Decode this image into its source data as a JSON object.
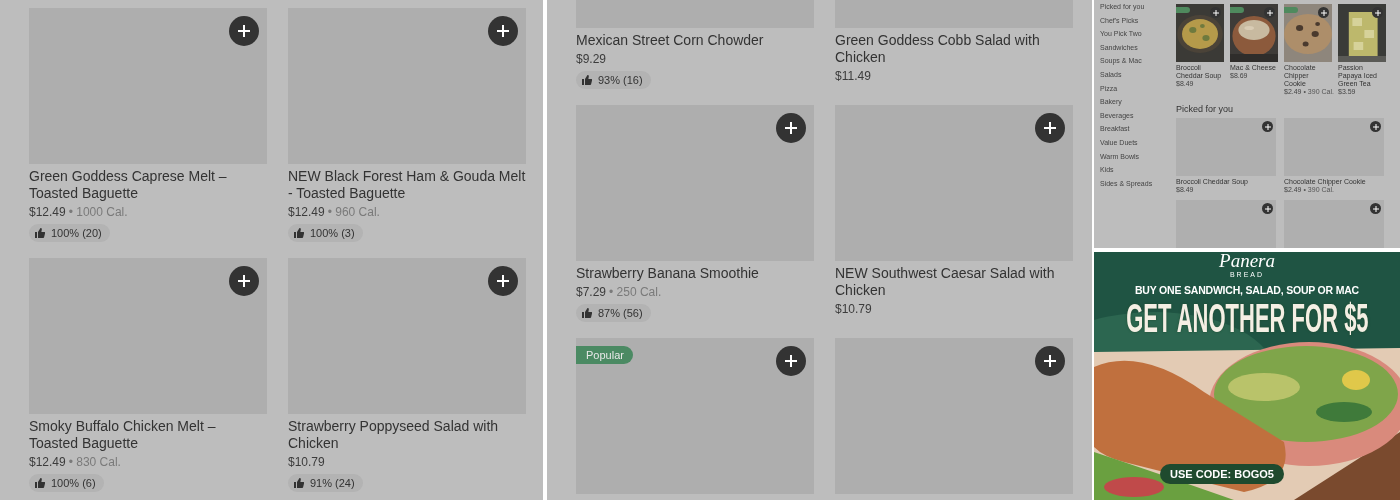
{
  "left_panel": {
    "cards": [
      {
        "kind": "full",
        "title": "Green Goddess Caprese Melt – Toasted Baguette",
        "price": "$12.49",
        "calories": "• 1000 Cal.",
        "rating": "100% (20)"
      },
      {
        "kind": "full",
        "title": "NEW Black Forest Ham & Gouda Melt - Toasted Baguette",
        "price": "$12.49",
        "calories": "• 960 Cal.",
        "rating": "100% (3)"
      },
      {
        "kind": "full",
        "title": "Smoky Buffalo Chicken Melt – Toasted Baguette",
        "price": "$12.49",
        "calories": "• 830 Cal.",
        "rating": "100% (6)"
      },
      {
        "kind": "full",
        "title": "Strawberry Poppyseed Salad with Chicken",
        "price": "$10.79",
        "rating": "91% (24)"
      }
    ]
  },
  "middle_panel": {
    "cards": [
      {
        "kind": "cropped",
        "title": "Mexican Street Corn Chowder",
        "price": "$9.29",
        "rating": "93% (16)"
      },
      {
        "kind": "cropped",
        "title": "Green Goddess Cobb Salad with Chicken",
        "price": "$11.49"
      },
      {
        "kind": "full",
        "title": "Strawberry Banana Smoothie",
        "price": "$7.29",
        "calories": "• 250 Cal.",
        "rating": "87% (56)"
      },
      {
        "kind": "full",
        "title": "NEW Southwest Caesar Salad with Chicken",
        "price": "$10.79"
      },
      {
        "kind": "full",
        "badge": "Popular"
      },
      {
        "kind": "full"
      }
    ]
  },
  "menu_panel": {
    "categories": [
      "Picked for you",
      "Chef's Picks",
      "You Pick Two",
      "Sandwiches",
      "Soups & Mac",
      "Salads",
      "Pizza",
      "Bakery",
      "Beverages",
      "Breakfast",
      "Value Duets",
      "Warm Bowls",
      "Kids",
      "Sides & Spreads"
    ],
    "featured": [
      {
        "name": "Broccoli Cheddar Soup",
        "price": "$8.49",
        "tagged": true
      },
      {
        "name": "Mac & Cheese",
        "price": "$8.69",
        "tagged": true
      },
      {
        "name": "Chocolate Chipper Cookie",
        "price": "$2.49",
        "calories": "• 390 Cal.",
        "tagged": true
      },
      {
        "name": "Passion Papaya Iced Green Tea",
        "price": "$3.59",
        "tagged": false
      }
    ],
    "section_title": "Picked for you",
    "picked": [
      {
        "kind": "item",
        "name": "Broccoli Cheddar Soup",
        "price": "$8.49"
      },
      {
        "kind": "item",
        "name": "Chocolate Chipper Cookie",
        "price": "$2.49",
        "calories": "• 390 Cal."
      },
      {
        "kind": "image_only"
      },
      {
        "kind": "image_only"
      }
    ]
  },
  "promo": {
    "logo": "Panera",
    "logo_subtitle": "BREAD",
    "headline": "BUY ONE SANDWICH, SALAD, SOUP OR MAC",
    "offer": "GET ANOTHER FOR $5",
    "code": "USE CODE: BOGO5"
  }
}
